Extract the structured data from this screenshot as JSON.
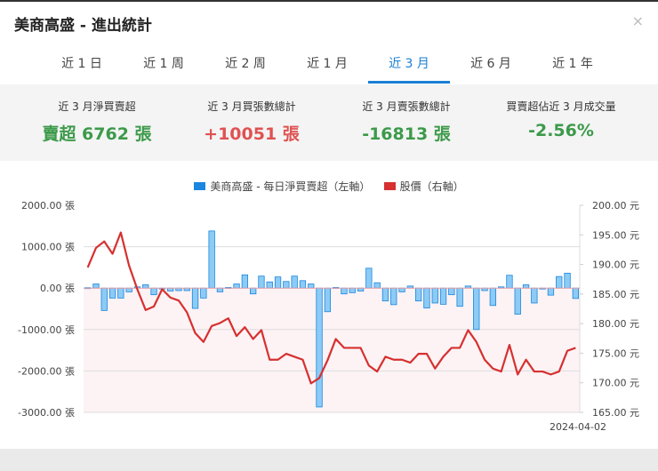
{
  "header": {
    "title": "美商高盛 - 進出統計",
    "close": "×"
  },
  "tabs": [
    "近 1 日",
    "近 1 周",
    "近 2 周",
    "近 1 月",
    "近 3 月",
    "近 6 月",
    "近 1 年"
  ],
  "active_tab": 4,
  "stats": [
    {
      "label": "近 3 月淨買賣超",
      "value": "賣超 6762 張",
      "color": "green"
    },
    {
      "label": "近 3 月買張數總計",
      "value": "+10051 張",
      "color": "red"
    },
    {
      "label": "近 3 月賣張數總計",
      "value": "-16813 張",
      "color": "green"
    },
    {
      "label": "買賣超佔近 3 月成交量",
      "value": "-2.56%",
      "color": "green"
    }
  ],
  "chart_data": {
    "type": "bar+line",
    "legend": [
      "美商高盛 - 每日淨買賣超（左軸）",
      "股價（右軸）"
    ],
    "colors": {
      "bar": "#8ccbf5",
      "bar_border": "#1a86e0",
      "line": "#d63030",
      "legend_bar": "#1a86e0"
    },
    "left_axis": {
      "ticks": [
        "2000.00 張",
        "1000.00 張",
        "0.00 張",
        "-1000.00 張",
        "-2000.00 張",
        "-3000.00 張"
      ],
      "range": [
        -3000,
        2000
      ]
    },
    "right_axis": {
      "ticks": [
        "200.00 元",
        "195.00 元",
        "190.00 元",
        "185.00 元",
        "180.00 元",
        "175.00 元",
        "170.00 元",
        "165.00 元"
      ],
      "range": [
        165,
        200
      ]
    },
    "x_last_label": "2024-04-02",
    "net": [
      10,
      100,
      -540,
      -240,
      -240,
      -90,
      30,
      80,
      -160,
      0,
      -70,
      -60,
      -60,
      -490,
      -240,
      1380,
      -90,
      15,
      100,
      320,
      -140,
      290,
      150,
      270,
      160,
      290,
      180,
      100,
      -2870,
      -570,
      15,
      -140,
      -110,
      -70,
      480,
      130,
      -310,
      -400,
      -90,
      50,
      -310,
      -480,
      -360,
      -390,
      -160,
      -440,
      50,
      -1000,
      -60,
      -420,
      30,
      310,
      -630,
      80,
      -360,
      -20,
      -170,
      280,
      360,
      -250
    ],
    "price": [
      189.5,
      192.8,
      193.9,
      191.8,
      195.4,
      189.8,
      185.8,
      182.3,
      182.9,
      185.8,
      184.4,
      183.9,
      181.9,
      178.4,
      176.9,
      179.6,
      180.1,
      180.9,
      177.9,
      179.4,
      177.4,
      178.9,
      173.9,
      173.9,
      174.9,
      174.4,
      173.9,
      169.9,
      170.8,
      173.8,
      177.4,
      175.9,
      175.9,
      175.9,
      172.9,
      171.9,
      174.4,
      173.9,
      173.9,
      173.4,
      174.9,
      174.9,
      172.4,
      174.4,
      175.9,
      175.9,
      178.9,
      176.9,
      173.9,
      172.4,
      171.9,
      176.4,
      171.4,
      173.9,
      171.9,
      171.9,
      171.4,
      171.9,
      175.4,
      175.9
    ]
  }
}
